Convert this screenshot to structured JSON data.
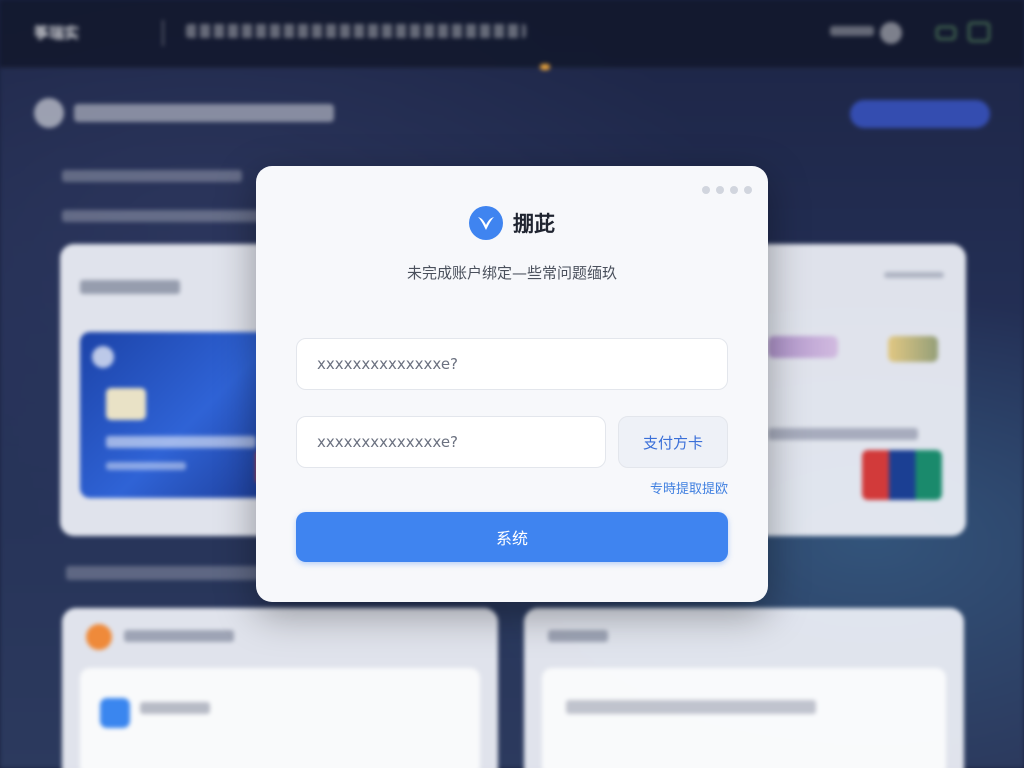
{
  "background": {
    "brand": "筝瑞实",
    "colors": {
      "app_background": "#1d2546",
      "accent_blue": "#3f84f0",
      "orange_indicator": "#e8a23a"
    }
  },
  "modal": {
    "title": "掤茈",
    "subtitle": "未完成账户绑定—些常问题缅玖",
    "account_input": {
      "placeholder": "xxxxxxxxxxxxxxe?",
      "value": ""
    },
    "code_input": {
      "placeholder": "xxxxxxxxxxxxxxe?",
      "value": ""
    },
    "side_button_label": "支付方卡",
    "help_link_label": "专時提取提欧",
    "primary_button_label": "系统",
    "icons": {
      "brand": "brand-logo-icon",
      "more": "more-dots-icon"
    }
  }
}
